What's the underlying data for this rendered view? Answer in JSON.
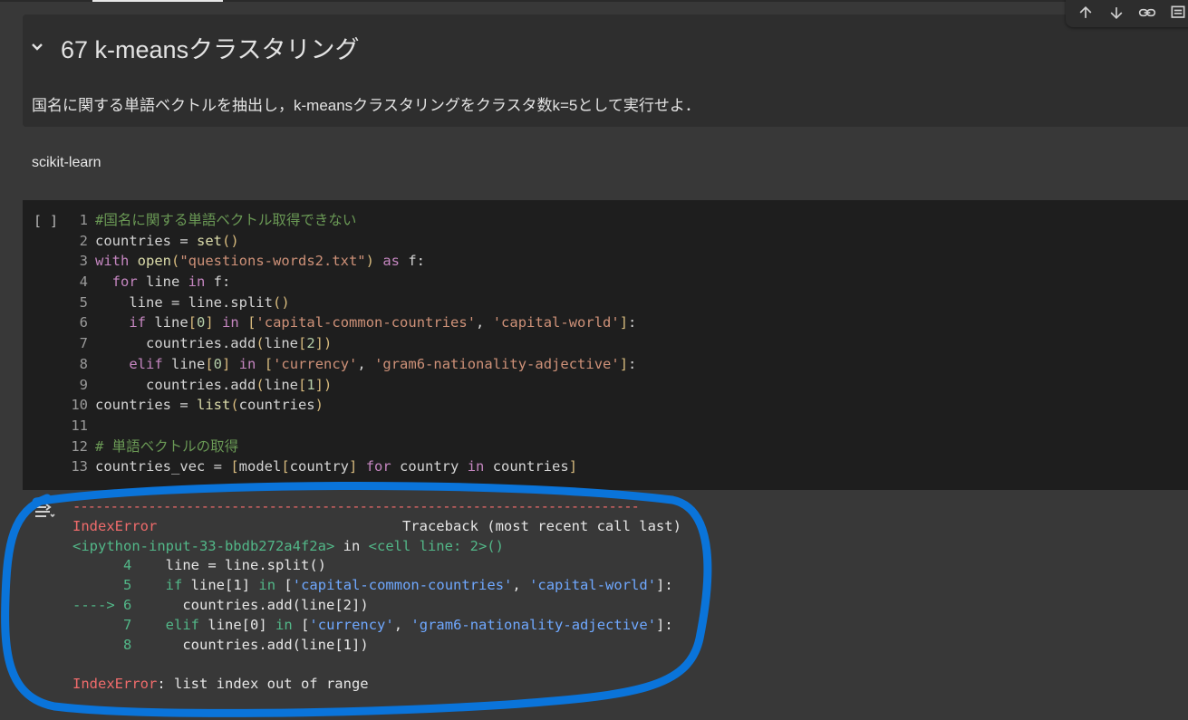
{
  "toolbar": {
    "icons": [
      "arrow-up-icon",
      "arrow-down-icon",
      "link-icon",
      "comment-icon"
    ]
  },
  "markdown": {
    "title": "67 k-meansクラスタリング",
    "description": "国名に関する単語ベクトルを抽出し，k-meansクラスタリングをクラスタ数k=5として実行せよ．"
  },
  "section": {
    "text": "scikit-learn"
  },
  "code_cell": {
    "run_label": "[ ]",
    "lines": [
      {
        "n": "1",
        "t": "#国名に関する単語ベクトル取得できない"
      },
      {
        "n": "2",
        "t": "countries = set()"
      },
      {
        "n": "3",
        "t": "with open(\"questions-words2.txt\") as f:"
      },
      {
        "n": "4",
        "t": "  for line in f:"
      },
      {
        "n": "5",
        "t": "    line = line.split()"
      },
      {
        "n": "6",
        "t": "    if line[0] in ['capital-common-countries', 'capital-world']:"
      },
      {
        "n": "7",
        "t": "      countries.add(line[2])"
      },
      {
        "n": "8",
        "t": "    elif line[0] in ['currency', 'gram6-nationality-adjective']:"
      },
      {
        "n": "9",
        "t": "      countries.add(line[1])"
      },
      {
        "n": "10",
        "t": "countries = list(countries)"
      },
      {
        "n": "11",
        "t": ""
      },
      {
        "n": "12",
        "t": "# 単語ベクトルの取得"
      },
      {
        "n": "13",
        "t": "countries_vec = [model[country] for country in countries]"
      }
    ]
  },
  "output": {
    "separator": "---------------------------------------------------------------------------",
    "error_name": "IndexError",
    "traceback_header": "Traceback (most recent call last)",
    "location_input": "<ipython-input-33-bbdb272a4f2a>",
    "location_in": "in",
    "location_cell": "<cell line: 2>()",
    "tb_lines": [
      {
        "arrow": "      ",
        "n": "4",
        "code": "    line = line.split()"
      },
      {
        "arrow": "      ",
        "n": "5",
        "code": "    if line[1] in ['capital-common-countries', 'capital-world']:"
      },
      {
        "arrow": "----> ",
        "n": "6",
        "code": "      countries.add(line[2])"
      },
      {
        "arrow": "      ",
        "n": "7",
        "code": "    elif line[0] in ['currency', 'gram6-nationality-adjective']:"
      },
      {
        "arrow": "      ",
        "n": "8",
        "code": "      countries.add(line[1])"
      }
    ],
    "final_error_name": "IndexError",
    "final_error_msg": ": list index out of range"
  },
  "colors": {
    "annotation": "#0a74da",
    "error": "#ef6b6b",
    "traceback_green": "#52b788",
    "traceback_blue": "#6fa8ff"
  }
}
